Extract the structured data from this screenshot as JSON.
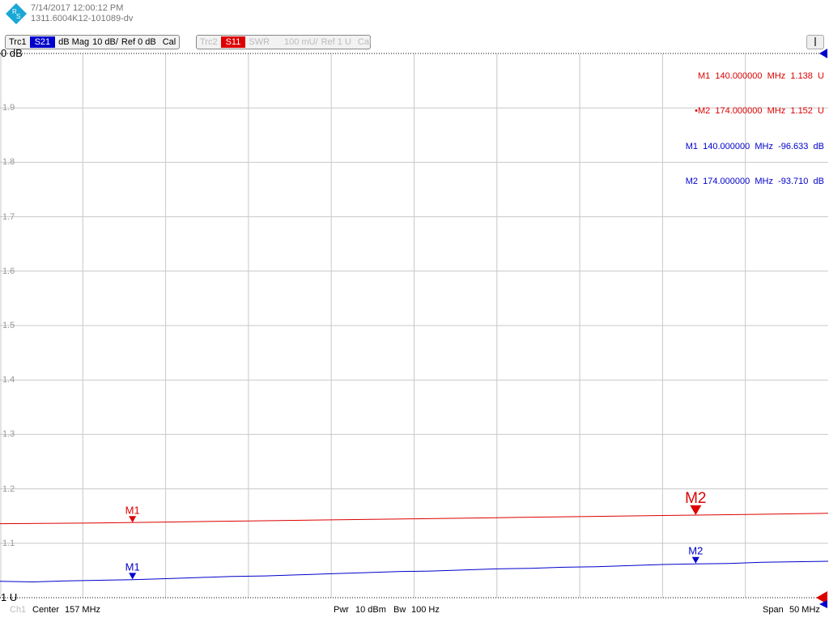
{
  "header": {
    "timestamp": "7/14/2017 12:00:12 PM",
    "device_id": "1311.6004K12-101089-dv"
  },
  "traces": [
    {
      "name": "Trc1",
      "param": "S21",
      "format": "dB Mag",
      "scale": "10 dB/",
      "ref": "Ref 0 dB",
      "cal": "Cal",
      "color": "#0000cc",
      "active": true
    },
    {
      "name": "Trc2",
      "param": "S11",
      "format": "SWR",
      "scale": "100 mU/",
      "ref": "Ref 1 U",
      "cal": "Cal",
      "color": "#dd0000",
      "active": false
    }
  ],
  "marker_info": {
    "red": [
      {
        "prefix": "",
        "label": "M1",
        "freq": "140.000000",
        "unit": "MHz",
        "value": "1.138",
        "vunit": "U"
      },
      {
        "prefix": "•",
        "label": "M2",
        "freq": "174.000000",
        "unit": "MHz",
        "value": "1.152",
        "vunit": "U"
      }
    ],
    "blue": [
      {
        "prefix": "",
        "label": "M1",
        "freq": "140.000000",
        "unit": "MHz",
        "value": "-96.633",
        "vunit": "dB"
      },
      {
        "prefix": "",
        "label": "M2",
        "freq": "174.000000",
        "unit": "MHz",
        "value": "-93.710",
        "vunit": "dB"
      }
    ]
  },
  "ref_labels": {
    "top": "0 dB",
    "bottom": "1 U"
  },
  "footer": {
    "channel": "Ch1",
    "center_label": "Center",
    "center_value": "157 MHz",
    "pwr_label": "Pwr",
    "pwr_value": "10 dBm",
    "bw_label": "Bw",
    "bw_value": "100 Hz",
    "span_label": "Span",
    "span_value": "50 MHz"
  },
  "chart_data": {
    "type": "line",
    "x_range_mhz": [
      132,
      182
    ],
    "swr_axis": {
      "ylim": [
        1.0,
        2.0
      ],
      "ticks": [
        1.1,
        1.2,
        1.3,
        1.4,
        1.5,
        1.6,
        1.7,
        1.8,
        1.9
      ]
    },
    "db_axis": {
      "ylim": [
        -100,
        0
      ]
    },
    "grid": true,
    "series": [
      {
        "name": "Trc2",
        "color": "#dd0000",
        "axis": "swr",
        "x": [
          132,
          137,
          142,
          147,
          152,
          157,
          162,
          167,
          172,
          177,
          182
        ],
        "y": [
          1.136,
          1.137,
          1.139,
          1.141,
          1.143,
          1.145,
          1.147,
          1.149,
          1.151,
          1.153,
          1.155
        ]
      },
      {
        "name": "Trc1",
        "color": "#0000cc",
        "axis": "db",
        "x": [
          132,
          134,
          136,
          138,
          140,
          142,
          144,
          146,
          148,
          150,
          152,
          154,
          156,
          158,
          160,
          162,
          164,
          166,
          168,
          170,
          172,
          174,
          176,
          178,
          180,
          182
        ],
        "y": [
          -97.0,
          -97.1,
          -96.9,
          -96.8,
          -96.7,
          -96.5,
          -96.3,
          -96.1,
          -96.0,
          -95.8,
          -95.6,
          -95.4,
          -95.2,
          -95.1,
          -94.9,
          -94.7,
          -94.6,
          -94.4,
          -94.3,
          -94.1,
          -93.9,
          -93.8,
          -93.7,
          -93.5,
          -93.4,
          -93.3
        ]
      }
    ],
    "markers": [
      {
        "label": "M1",
        "series": "Trc2",
        "x": 140,
        "y": 1.138,
        "color": "#dd0000"
      },
      {
        "label": "M2",
        "series": "Trc2",
        "x": 174,
        "y": 1.152,
        "color": "#dd0000"
      },
      {
        "label": "M1",
        "series": "Trc1",
        "x": 140,
        "y": -96.633,
        "color": "#0000cc"
      },
      {
        "label": "M2",
        "series": "Trc1",
        "x": 174,
        "y": -93.71,
        "color": "#0000cc"
      }
    ]
  }
}
